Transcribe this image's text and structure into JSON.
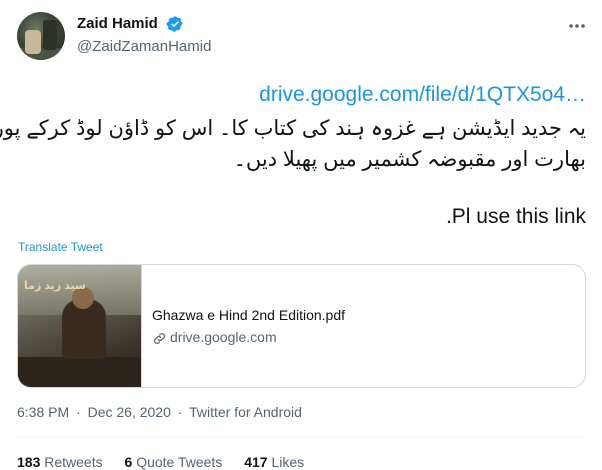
{
  "author": {
    "display_name": "Zaid Hamid",
    "handle": "@ZaidZamanHamid",
    "verified": true
  },
  "tweet": {
    "link_text": "drive.google.com/file/d/1QTX5o4…",
    "urdu_line_1": "یہ جدید ایڈیشن ہے غزوہ ہند کی کتاب کا۔ اس کو ڈاؤن لوڈ کرکے پورے",
    "urdu_line_2": "بھارت اور مقبوضہ کشمیر میں پھیلا دیں۔",
    "english_line": ".Pl use this link",
    "translate_label": "Translate Tweet"
  },
  "card": {
    "image_caption": "سید زید زما",
    "title": "Ghazwa e Hind 2nd Edition.pdf",
    "domain": "drive.google.com"
  },
  "meta": {
    "time": "6:38 PM",
    "date": "Dec 26, 2020",
    "source": "Twitter for Android",
    "separator": "·"
  },
  "stats": {
    "retweets_count": "183",
    "retweets_label": "Retweets",
    "quotes_count": "6",
    "quotes_label": "Quote Tweets",
    "likes_count": "417",
    "likes_label": "Likes"
  },
  "colors": {
    "link_blue": "#1b95e0",
    "text_secondary": "#536471",
    "verified_blue": "#1d9bf0"
  },
  "icons": {
    "verified": "verified-badge-icon",
    "more": "more-horizontal-icon",
    "card_domain": "link-icon"
  }
}
